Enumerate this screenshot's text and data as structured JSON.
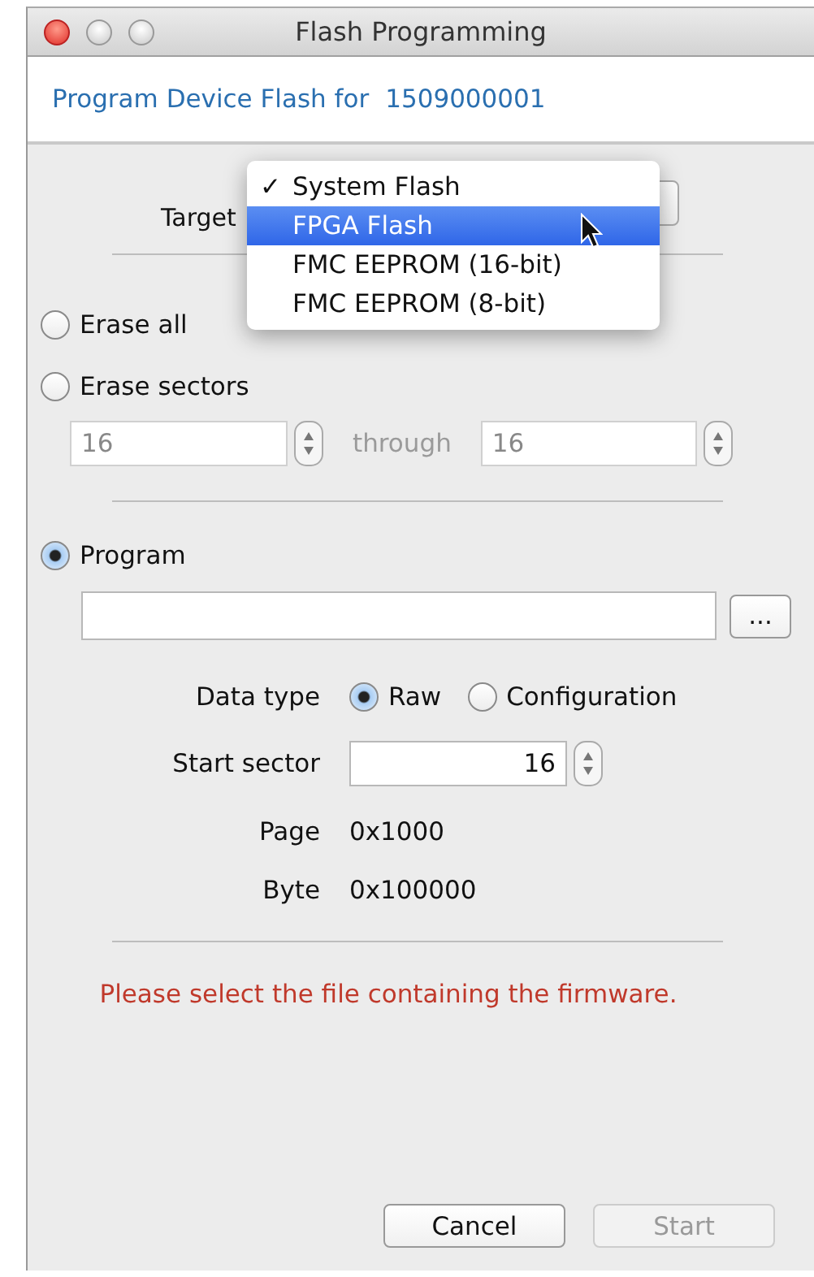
{
  "window": {
    "title": "Flash Programming"
  },
  "header": {
    "label": "Program Device Flash for",
    "device": "1509000001"
  },
  "target": {
    "label": "Target",
    "check_symbol": "✓",
    "menu": [
      {
        "label": "System Flash",
        "checked": true,
        "highlighted": false
      },
      {
        "label": "FPGA Flash",
        "checked": false,
        "highlighted": true
      },
      {
        "label": "FMC EEPROM (16-bit)",
        "checked": false,
        "highlighted": false
      },
      {
        "label": "FMC EEPROM (8-bit)",
        "checked": false,
        "highlighted": false
      }
    ]
  },
  "modes": [
    {
      "label": "Erase all",
      "selected": false
    },
    {
      "label": "Erase sectors",
      "selected": false
    },
    {
      "label": "Program",
      "selected": true
    }
  ],
  "sector_range": {
    "from": "16",
    "through": "through",
    "to": "16",
    "disabled": true
  },
  "browse_button": "...",
  "data_type": {
    "label": "Data type",
    "options": [
      {
        "label": "Raw",
        "selected": true
      },
      {
        "label": "Configuration",
        "selected": false
      }
    ]
  },
  "start_sector": {
    "label": "Start sector",
    "value": "16"
  },
  "info": [
    {
      "label": "Page",
      "value": "0x1000"
    },
    {
      "label": "Byte",
      "value": "0x100000"
    }
  ],
  "message": "Please select the file containing the firmware.",
  "buttons": [
    {
      "label": "Cancel",
      "disabled": false
    },
    {
      "label": "Start",
      "disabled": true
    }
  ]
}
